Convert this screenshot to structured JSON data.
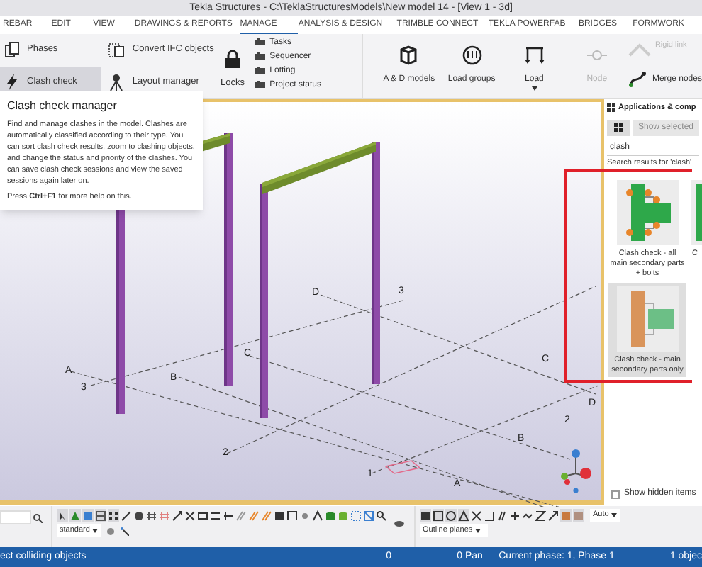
{
  "window": {
    "title": "Tekla Structures - C:\\TeklaStructuresModels\\New model 14  - [View 1 - 3d]"
  },
  "menu_tabs": [
    {
      "label": "REBAR",
      "selected": false
    },
    {
      "label": "EDIT",
      "selected": false
    },
    {
      "label": "VIEW",
      "selected": false
    },
    {
      "label": "DRAWINGS & REPORTS",
      "selected": false
    },
    {
      "label": "MANAGE",
      "selected": true
    },
    {
      "label": "ANALYSIS & DESIGN",
      "selected": false
    },
    {
      "label": "TRIMBLE CONNECT",
      "selected": false
    },
    {
      "label": "TEKLA POWERFAB",
      "selected": false
    },
    {
      "label": "BRIDGES",
      "selected": false
    },
    {
      "label": "FORMWORK",
      "selected": false
    }
  ],
  "ribbon": {
    "left_buttons": [
      {
        "label": "Phases",
        "selected": false
      },
      {
        "label": "Clash check",
        "selected": true
      }
    ],
    "middle_buttons": [
      {
        "label": "Convert IFC objects"
      },
      {
        "label": "Layout manager"
      }
    ],
    "locks": {
      "label": "Locks"
    },
    "small_buttons": [
      {
        "label": "Tasks"
      },
      {
        "label": "Sequencer"
      },
      {
        "label": "Lotting"
      },
      {
        "label": "Project status"
      }
    ],
    "analysis_buttons": [
      {
        "label": "A & D models",
        "disabled": false
      },
      {
        "label": "Load groups",
        "disabled": false
      },
      {
        "label": "Load",
        "disabled": false,
        "dropdown": true
      },
      {
        "label": "Node",
        "disabled": true
      }
    ],
    "rigid_link": {
      "label": "Rigid link",
      "disabled": true
    },
    "merge_nodes": {
      "label": "Merge nodes",
      "disabled": false
    }
  },
  "tooltip": {
    "title": "Clash check manager",
    "body": "Find and manage clashes in the model. Clashes are automatically classified according to their type. You can sort clash check results, zoom to clashing objects, and change the status and priority of the clashes. You can save clash check sessions and view the saved sessions again later on.",
    "hint": "Press **Ctrl+F1** for more help on this."
  },
  "viewport": {
    "grid_labels": [
      "A",
      "3",
      "B",
      "C",
      "D",
      "3",
      "2",
      "1",
      "A",
      "B",
      "2",
      "C",
      "D"
    ]
  },
  "side_panel": {
    "title": "Applications & comp",
    "show_selected": {
      "label": "Show selected",
      "disabled": true
    },
    "search": {
      "value": "clash"
    },
    "results_label": "Search results for 'clash'",
    "results": [
      {
        "label": "Clash check - all main secondary parts + bolts",
        "selected": false
      },
      {
        "label": "C",
        "selected": false
      },
      {
        "label": "Clash check - main secondary parts only",
        "selected": true
      }
    ],
    "show_hidden": {
      "label": "Show hidden items",
      "checked": false
    }
  },
  "bottom_toolbar": {
    "view_dropdown": "standard",
    "planes_dropdown": "Outline planes",
    "auto_dropdown": "Auto"
  },
  "status_bar": [
    "ect colliding objects",
    "0",
    "0 Pan",
    "Current phase: 1, Phase 1",
    "1 objec"
  ]
}
